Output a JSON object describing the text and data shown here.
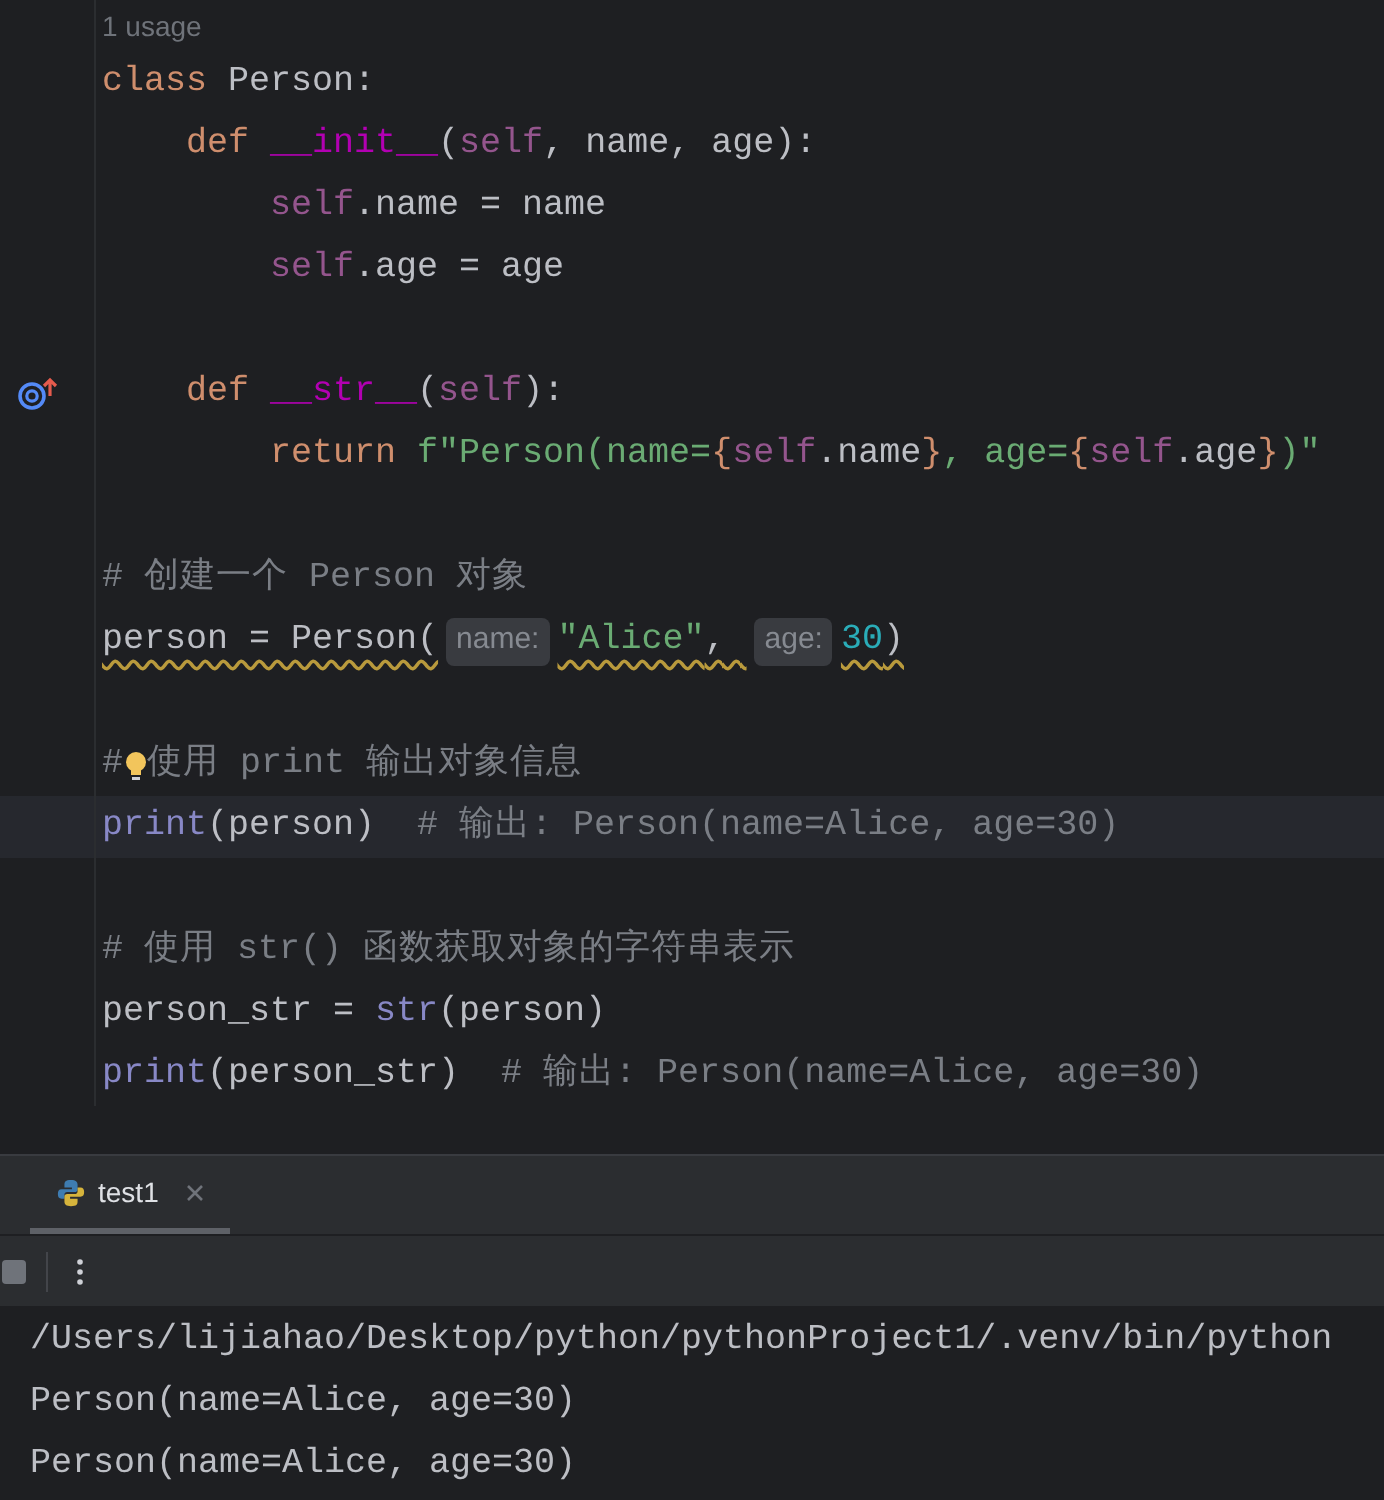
{
  "editor": {
    "usage": "1 usage",
    "lines": [
      {
        "current": false,
        "tokens": [
          {
            "kind": "keyword",
            "text": "class"
          },
          {
            "kind": "plain",
            "text": " Person:"
          }
        ]
      },
      {
        "current": false,
        "tokens": [
          {
            "kind": "keyword",
            "text": "    def"
          },
          {
            "kind": "magic",
            "text": " __init__"
          },
          {
            "kind": "plain",
            "text": "("
          },
          {
            "kind": "self",
            "text": "self"
          },
          {
            "kind": "plain",
            "text": ", name, age):"
          }
        ]
      },
      {
        "current": false,
        "tokens": [
          {
            "kind": "self",
            "text": "        self"
          },
          {
            "kind": "plain",
            "text": ".name = name"
          }
        ]
      },
      {
        "current": false,
        "tokens": [
          {
            "kind": "self",
            "text": "        self"
          },
          {
            "kind": "plain",
            "text": ".age = age"
          }
        ]
      },
      {
        "current": false
      },
      {
        "current": false,
        "gutter_icon": {
          "kind": "override"
        },
        "tokens": [
          {
            "kind": "keyword",
            "text": "    def"
          },
          {
            "kind": "magic",
            "text": " __str__"
          },
          {
            "kind": "plain",
            "text": "("
          },
          {
            "kind": "self",
            "text": "self"
          },
          {
            "kind": "plain",
            "text": "):"
          }
        ]
      },
      {
        "current": false,
        "tokens": [
          {
            "kind": "keyword",
            "text": "        return"
          },
          {
            "kind": "string",
            "text": " f\"Person(name="
          },
          {
            "kind": "brace",
            "text": "{"
          },
          {
            "kind": "self",
            "text": "self"
          },
          {
            "kind": "plain",
            "text": ".name"
          },
          {
            "kind": "brace",
            "text": "}"
          },
          {
            "kind": "string",
            "text": ", age="
          },
          {
            "kind": "brace",
            "text": "{"
          },
          {
            "kind": "self",
            "text": "self"
          },
          {
            "kind": "plain",
            "text": ".age"
          },
          {
            "kind": "brace",
            "text": "}"
          },
          {
            "kind": "string",
            "text": ")\""
          }
        ]
      },
      {
        "current": false
      },
      {
        "current": false,
        "tokens": [
          {
            "kind": "comment",
            "text": "# 创建一个 Person 对象"
          }
        ]
      },
      {
        "current": false,
        "tokens": [
          {
            "kind": "plain",
            "text": "person = Person(",
            "warning": true
          },
          {
            "kind": "hint",
            "text": "name:"
          },
          {
            "kind": "string",
            "text": "\"Alice\"",
            "warning": true
          },
          {
            "kind": "plain",
            "text": ", ",
            "warning": true
          },
          {
            "kind": "hint",
            "text": "age:"
          },
          {
            "kind": "number",
            "text": "30",
            "warning": true
          },
          {
            "kind": "plain",
            "text": ")",
            "warning": true
          }
        ]
      },
      {
        "current": false
      },
      {
        "current": false,
        "tokens": [
          {
            "kind": "comment",
            "text": "#"
          },
          {
            "kind": "bulb"
          },
          {
            "kind": "comment",
            "text": "使用 print 输出对象信息"
          }
        ]
      },
      {
        "current": true,
        "tokens": [
          {
            "kind": "builtin",
            "text": "print"
          },
          {
            "kind": "plain",
            "text": "(person)"
          },
          {
            "kind": "comment",
            "text": "  # 输出: Person(name=Alice, age=30)"
          }
        ]
      },
      {
        "current": false
      },
      {
        "current": false,
        "tokens": [
          {
            "kind": "comment",
            "text": "# 使用 str() 函数获取对象的字符串表示"
          }
        ]
      },
      {
        "current": false,
        "tokens": [
          {
            "kind": "plain",
            "text": "person_str = "
          },
          {
            "kind": "builtin",
            "text": "str"
          },
          {
            "kind": "plain",
            "text": "(person)"
          }
        ]
      },
      {
        "current": false,
        "tokens": [
          {
            "kind": "builtin",
            "text": "print"
          },
          {
            "kind": "plain",
            "text": "(person_str)"
          },
          {
            "kind": "comment",
            "text": "  # 输出: Person(name=Alice, age=30)"
          }
        ]
      }
    ]
  },
  "run_panel": {
    "tabs": [
      {
        "label": "test1",
        "selected": true
      }
    ],
    "output": [
      "/Users/lijiahao/Desktop/python/pythonProject1/.venv/bin/python",
      "Person(name=Alice, age=30)",
      "Person(name=Alice, age=30)"
    ]
  }
}
